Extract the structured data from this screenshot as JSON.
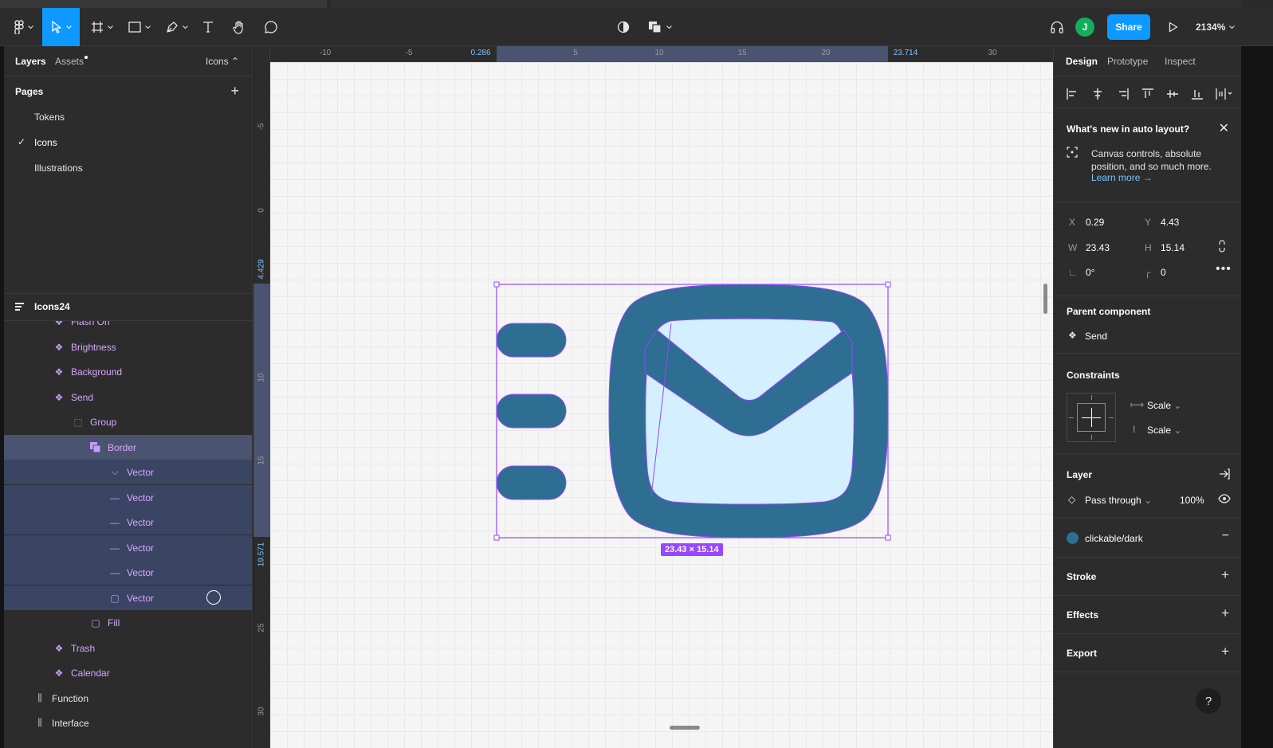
{
  "toolbar": {
    "share_label": "Share",
    "avatar_initial": "J",
    "zoom_label": "2134%"
  },
  "left_panel": {
    "tab_layers": "Layers",
    "tab_assets": "Assets",
    "page_filter": "Icons",
    "pages_title": "Pages",
    "pages": [
      {
        "label": "Tokens",
        "active": false
      },
      {
        "label": "Icons",
        "active": true
      },
      {
        "label": "Illustrations",
        "active": false
      }
    ],
    "layers_title": "Icons24",
    "layers": [
      {
        "label": "Flash On",
        "type": "component"
      },
      {
        "label": "Brightness",
        "type": "component"
      },
      {
        "label": "Background",
        "type": "component"
      },
      {
        "label": "Send",
        "type": "component"
      },
      {
        "label": "Group",
        "type": "group"
      },
      {
        "label": "Border",
        "type": "boolean"
      },
      {
        "label": "Vector",
        "type": "vector"
      },
      {
        "label": "Vector",
        "type": "line"
      },
      {
        "label": "Vector",
        "type": "line"
      },
      {
        "label": "Vector",
        "type": "line"
      },
      {
        "label": "Vector",
        "type": "line"
      },
      {
        "label": "Vector",
        "type": "rect"
      },
      {
        "label": "Fill",
        "type": "rect"
      },
      {
        "label": "Trash",
        "type": "component"
      },
      {
        "label": "Calendar",
        "type": "component"
      },
      {
        "label": "Function",
        "type": "frame"
      },
      {
        "label": "Interface",
        "type": "frame"
      }
    ]
  },
  "rulers": {
    "top": [
      "-10",
      "-5",
      "0.286",
      "5",
      "10",
      "15",
      "20",
      "23.714",
      "30"
    ],
    "left": [
      "-5",
      "0",
      "4.429",
      "10",
      "15",
      "19.571",
      "25",
      "30"
    ]
  },
  "canvas": {
    "dimension_badge": "23.43 × 15.14"
  },
  "right_panel": {
    "tab_design": "Design",
    "tab_prototype": "Prototype",
    "tab_inspect": "Inspect",
    "whats_new": {
      "title": "What's new in auto layout?",
      "body": "Canvas controls, absolute position, and so much more.",
      "link": "Learn more →"
    },
    "transform": {
      "x_label": "X",
      "x": "0.29",
      "y_label": "Y",
      "y": "4.43",
      "w_label": "W",
      "w": "23.43",
      "h_label": "H",
      "h": "15.14",
      "rotation": "0°",
      "radius": "0"
    },
    "parent_component": {
      "title": "Parent component",
      "name": "Send"
    },
    "constraints": {
      "title": "Constraints",
      "horizontal": "Scale",
      "vertical": "Scale"
    },
    "layer": {
      "title": "Layer",
      "blend": "Pass through",
      "opacity": "100%"
    },
    "fill": {
      "style_name": "clickable/dark",
      "color": "#2d6e92"
    },
    "stroke_title": "Stroke",
    "effects_title": "Effects",
    "export_title": "Export",
    "help": "?"
  },
  "colors": {
    "accent": "#0d99ff",
    "component": "#9747ff",
    "icon_fill": "#2d6e92",
    "icon_inner": "#d4efff"
  }
}
